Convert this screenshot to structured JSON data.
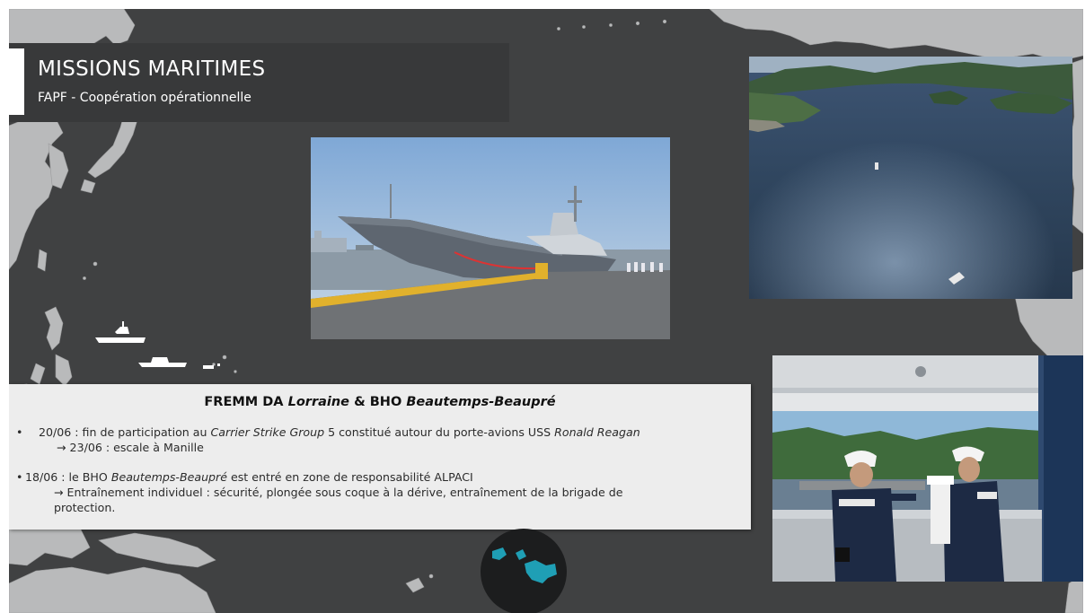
{
  "header": {
    "title": "MISSIONS MARITIMES",
    "subtitle": "FAPF - Coopération opérationnelle"
  },
  "info_box": {
    "title_prefix": "FREMM DA ",
    "title_ship1": "Lorraine",
    "title_mid": " & BHO ",
    "title_ship2": "Beautemps-Beaupré",
    "bullets": [
      {
        "dot": "•",
        "l1_a": "20/06 : fin de participation au ",
        "l1_b": "Carrier Strike Group",
        "l1_c": " 5 constitué autour du porte-avions USS ",
        "l1_d": "Ronald Reagan",
        "l2": "→ 23/06 : escale à Manille"
      },
      {
        "dot": "•",
        "l1_a": "18/06 : le BHO ",
        "l1_b": "Beautemps-Beaupré",
        "l1_c": " est entré en zone de responsabilité ALPACI",
        "l2": "→ Entraînement individuel : sécurité, plongée sous coque à la dérive, entraînement de la brigade de",
        "l3": "protection."
      }
    ]
  },
  "images": {
    "frigate": "photo-frigate-at-pier",
    "bay": "photo-aerial-bay",
    "bridge": "photo-sailors-on-bridge-wing"
  },
  "colors": {
    "background": "#404142",
    "land": "#b9babb",
    "title_band": "#38393a",
    "info_box": "#ededed",
    "polynesia_islands": "#1f9fb5"
  }
}
